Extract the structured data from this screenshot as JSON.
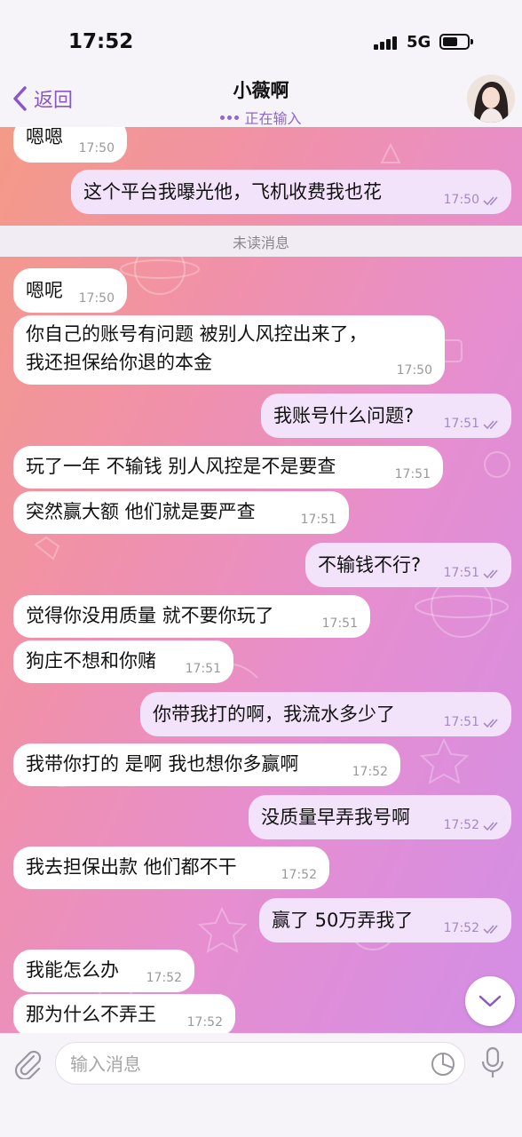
{
  "status_bar": {
    "time": "17:52",
    "network": "5G"
  },
  "header": {
    "back_label": "返回",
    "title": "小薇啊",
    "subtitle": "正在输入"
  },
  "divider": {
    "label": "未读消息"
  },
  "messages": [
    {
      "dir": "in",
      "text": "嗯嗯",
      "time": "17:50"
    },
    {
      "dir": "out",
      "text": "这个平台我曝光他，飞机收费我也花",
      "time": "17:50"
    },
    {
      "dir": "in",
      "text": "嗯呢",
      "time": "17:50"
    },
    {
      "dir": "in",
      "text": "你自己的账号有问题 被别人风控出来了，",
      "text2": "我还担保给你退的本金",
      "time": "17:50"
    },
    {
      "dir": "out",
      "text": "我账号什么问题?",
      "time": "17:51"
    },
    {
      "dir": "in",
      "text": "玩了一年 不输钱 别人风控是不是要查",
      "time": "17:51"
    },
    {
      "dir": "in",
      "text": "突然赢大额 他们就是要严查",
      "time": "17:51"
    },
    {
      "dir": "out",
      "text": "不输钱不行?",
      "time": "17:51"
    },
    {
      "dir": "in",
      "text": "觉得你没用质量 就不要你玩了",
      "time": "17:51"
    },
    {
      "dir": "in",
      "text": "狗庄不想和你赌",
      "time": "17:51"
    },
    {
      "dir": "out",
      "text": "你带我打的啊，我流水多少了",
      "time": "17:51"
    },
    {
      "dir": "in",
      "text": "我带你打的 是啊 我也想你多赢啊",
      "time": "17:52"
    },
    {
      "dir": "out",
      "text": "没质量早弄我号啊",
      "time": "17:52"
    },
    {
      "dir": "in",
      "text": "我去担保出款 他们都不干",
      "time": "17:52"
    },
    {
      "dir": "out",
      "text": "赢了 50万弄我了",
      "time": "17:52"
    },
    {
      "dir": "in",
      "text": "我能怎么办",
      "time": "17:52"
    },
    {
      "dir": "in",
      "text": "那为什么不弄王",
      "time": "17:52"
    }
  ],
  "composer": {
    "placeholder": "输入消息"
  },
  "colors": {
    "accent": "#8a57c7",
    "incoming_bubble": "#ffffff",
    "outgoing_bubble": "#f2e3fa",
    "background_gradient": [
      "#f49a87",
      "#f191a8",
      "#e68ed0",
      "#d38ee6"
    ]
  },
  "icons": {
    "back": "chevron-left-icon",
    "typing": "typing-dots-icon",
    "read": "double-check-icon",
    "scroll_down": "chevron-down-icon",
    "attach": "paperclip-icon",
    "sticker": "sticker-icon",
    "mic": "microphone-icon"
  }
}
